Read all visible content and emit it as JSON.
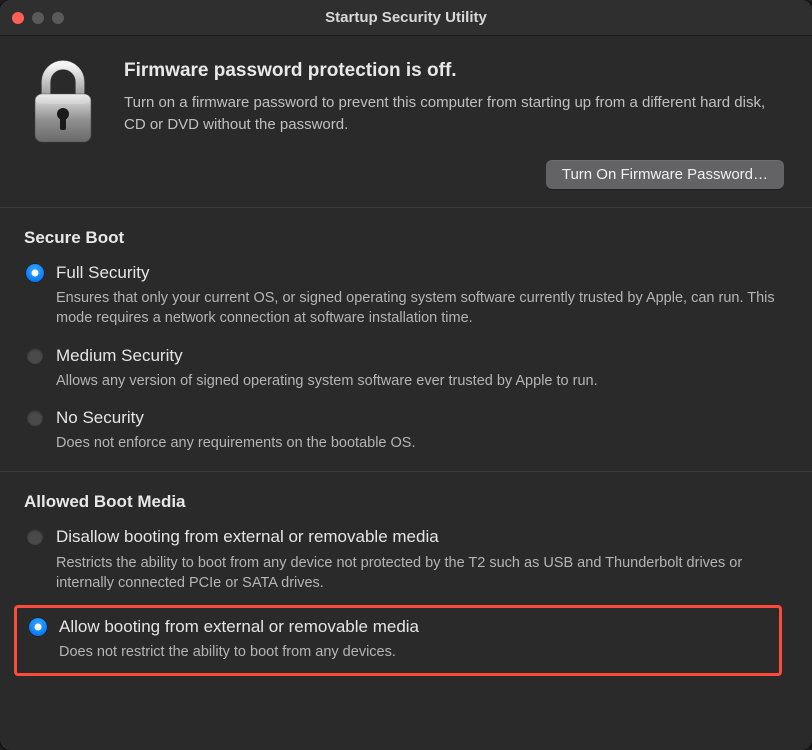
{
  "window": {
    "title": "Startup Security Utility"
  },
  "firmware": {
    "heading": "Firmware password protection is off.",
    "description": "Turn on a firmware password to prevent this computer from starting up from a different hard disk, CD or DVD without the password.",
    "button_label": "Turn On Firmware Password…"
  },
  "secure_boot": {
    "title": "Secure Boot",
    "options": [
      {
        "label": "Full Security",
        "description": "Ensures that only your current OS, or signed operating system software currently trusted by Apple, can run. This mode requires a network connection at software installation time.",
        "selected": true
      },
      {
        "label": "Medium Security",
        "description": "Allows any version of signed operating system software ever trusted by Apple to run.",
        "selected": false
      },
      {
        "label": "No Security",
        "description": "Does not enforce any requirements on the bootable OS.",
        "selected": false
      }
    ]
  },
  "boot_media": {
    "title": "Allowed Boot Media",
    "options": [
      {
        "label": "Disallow booting from external or removable media",
        "description": "Restricts the ability to boot from any device not protected by the T2 such as USB and Thunderbolt drives or internally connected PCIe or SATA drives.",
        "selected": false,
        "highlighted": false
      },
      {
        "label": "Allow booting from external or removable media",
        "description": "Does not restrict the ability to boot from any devices.",
        "selected": true,
        "highlighted": true
      }
    ]
  }
}
